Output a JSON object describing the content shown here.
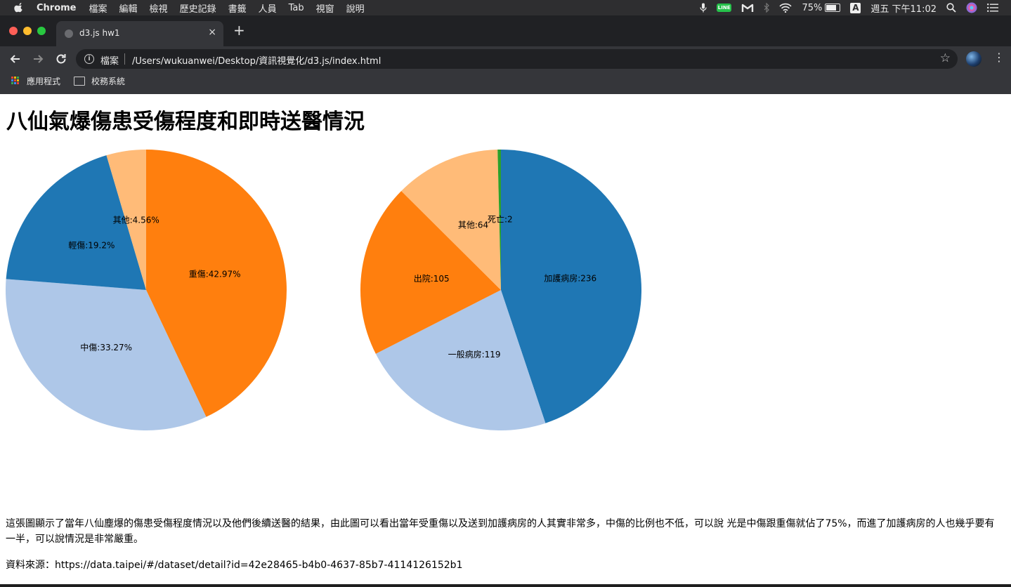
{
  "menubar": {
    "app_name": "Chrome",
    "menus": [
      "檔案",
      "編輯",
      "檢視",
      "歷史記錄",
      "書籤",
      "人員",
      "Tab",
      "視窗",
      "說明"
    ],
    "line_badge": "LINE",
    "battery": "75%",
    "input_source": "A",
    "clock": "週五 下午11:02"
  },
  "browser": {
    "tab_title": "d3.js hw1",
    "tab_close": "×",
    "new_tab": "+",
    "address_scheme": "檔案",
    "address_url": "/Users/wukuanwei/Desktop/資訊視覺化/d3.js/index.html",
    "bookmarks": [
      "應用程式",
      "校務系統"
    ]
  },
  "page": {
    "title": "八仙氣爆傷患受傷程度和即時送醫情況",
    "description": "這張圖顯示了當年八仙塵爆的傷患受傷程度情況以及他們後續送醫的結果，由此圖可以看出當年受重傷以及送到加護病房的人其實非常多，中傷的比例也不低，可以說 光是中傷跟重傷就佔了75%，而進了加護病房的人也幾乎要有一半，可以說情況是非常嚴重。",
    "source": "資料來源：https://data.taipei/#/dataset/detail?id=42e28465-b4b0-4637-85b7-4114126152b1"
  },
  "chart_data": [
    {
      "type": "pie",
      "title": "",
      "slices": [
        {
          "label": "重傷",
          "value": 42.97,
          "display": "重傷:42.97%",
          "color": "#ff7f0e"
        },
        {
          "label": "中傷",
          "value": 33.27,
          "display": "中傷:33.27%",
          "color": "#aec7e8"
        },
        {
          "label": "輕傷",
          "value": 19.2,
          "display": "輕傷:19.2%",
          "color": "#1f77b4"
        },
        {
          "label": "其他",
          "value": 4.56,
          "display": "其他:4.56%",
          "color": "#ffbb78"
        }
      ]
    },
    {
      "type": "pie",
      "title": "",
      "slices": [
        {
          "label": "加護病房",
          "value": 236,
          "display": "加護病房:236",
          "color": "#1f77b4"
        },
        {
          "label": "一般病房",
          "value": 119,
          "display": "一般病房:119",
          "color": "#aec7e8"
        },
        {
          "label": "出院",
          "value": 105,
          "display": "出院:105",
          "color": "#ff7f0e"
        },
        {
          "label": "其他",
          "value": 64,
          "display": "其他:64",
          "color": "#ffbb78"
        },
        {
          "label": "死亡",
          "value": 2,
          "display": "死亡:2",
          "color": "#2ca02c"
        }
      ]
    }
  ]
}
